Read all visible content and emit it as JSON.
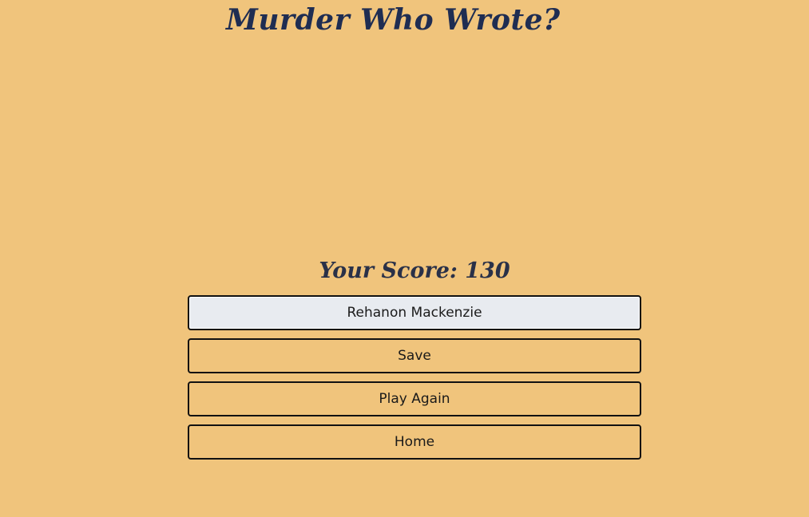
{
  "header": {
    "title": "Murder Who Wrote?"
  },
  "result": {
    "score_label": "Your Score:",
    "score_value": "130"
  },
  "form": {
    "name_value": "Rehanon Mackenzie",
    "save_label": "Save",
    "play_again_label": "Play Again",
    "home_label": "Home"
  },
  "colors": {
    "background": "#f0c47c",
    "title": "#1f2d52",
    "input_background": "#e8ebf0",
    "border": "#111111"
  }
}
